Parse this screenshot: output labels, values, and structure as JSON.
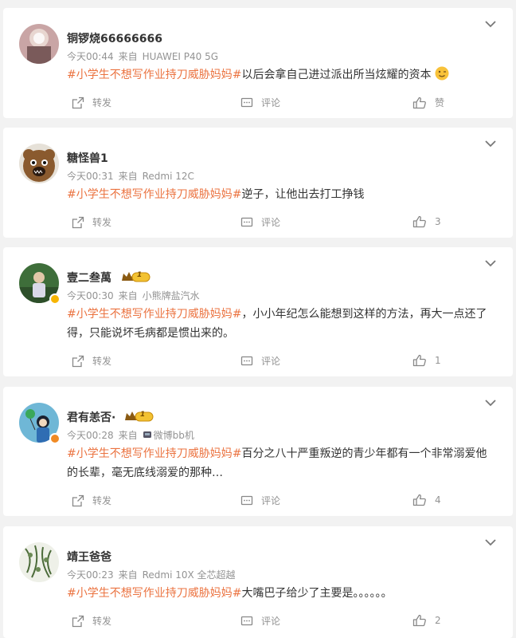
{
  "accent": "#eb7340",
  "labels": {
    "repost": "转发",
    "comment": "评论",
    "like": "赞"
  },
  "posts": [
    {
      "user": "铜锣烧66666666",
      "time": "今天00:44",
      "source_prefix": "来自",
      "source": "HUAWEI P40 5G",
      "topic": "#小学生不想写作业持刀威胁妈妈#",
      "text": "以后会拿自己进过派出所当炫耀的资本",
      "emoji": "winking-face-icon",
      "likes": "赞"
    },
    {
      "user": "糖怪兽1",
      "time": "今天00:31",
      "source_prefix": "来自",
      "source": "Redmi 12C",
      "topic": "#小学生不想写作业持刀威胁妈妈#",
      "text": "逆子，让他出去打工挣钱",
      "likes": "3"
    },
    {
      "user": "壹二叁萬",
      "badge": "1",
      "time": "今天00:30",
      "source_prefix": "来自",
      "source": "小熊牌盐汽水",
      "topic": "#小学生不想写作业持刀威胁妈妈#",
      "text": "，小小年纪怎么能想到这样的方法，再大一点还了得，只能说坏毛病都是惯出来的。",
      "likes": "1"
    },
    {
      "user": "君有恙否·",
      "badge": "1",
      "time": "今天00:28",
      "source_prefix": "来自",
      "source": "微博bb机",
      "topic": "#小学生不想写作业持刀威胁妈妈#",
      "text": "百分之八十严重叛逆的青少年都有一个非常溺爱他的长辈，毫无底线溺爱的那种…",
      "likes": "4"
    },
    {
      "user": "靖王爸爸",
      "time": "今天00:23",
      "source_prefix": "来自",
      "source": "Redmi 10X 全芯超越",
      "topic": "#小学生不想写作业持刀威胁妈妈#",
      "text": "大嘴巴子给少了主要是。。。。。。",
      "likes": "2"
    }
  ]
}
